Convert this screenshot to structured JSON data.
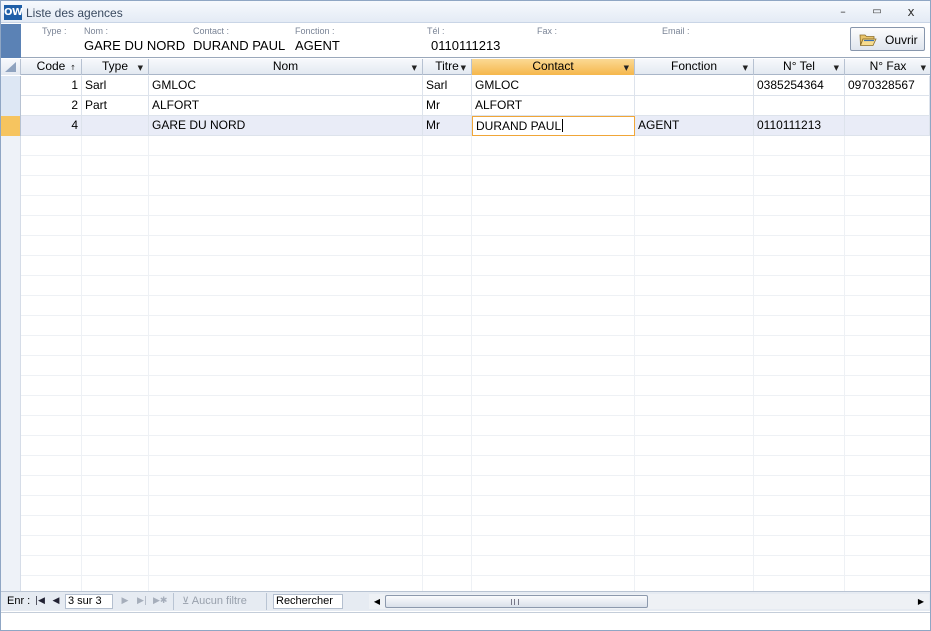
{
  "window": {
    "app_icon_text": "OW",
    "title": "Liste des agences",
    "minimize": "–",
    "maximize": "▭",
    "close": "x"
  },
  "header": {
    "labels": {
      "type": "Type :",
      "nom": "Nom :",
      "contact": "Contact :",
      "fonction": "Fonction :",
      "tel": "Tél :",
      "fax": "Fax :",
      "email": "Email :"
    },
    "values": {
      "nom": "GARE DU NORD",
      "contact": "DURAND PAUL",
      "fonction": "AGENT",
      "tel": "0110111213"
    },
    "open_button": "Ouvrir"
  },
  "grid": {
    "columns": [
      {
        "key": "code",
        "label": "Code",
        "sort": "↑"
      },
      {
        "key": "type",
        "label": "Type",
        "sort": "▼"
      },
      {
        "key": "nom",
        "label": "Nom",
        "sort": "▼"
      },
      {
        "key": "titre",
        "label": "Titre",
        "sort": "▼"
      },
      {
        "key": "contact",
        "label": "Contact",
        "sort": "▼"
      },
      {
        "key": "fonction",
        "label": "Fonction",
        "sort": "▼"
      },
      {
        "key": "tel",
        "label": "N° Tel",
        "sort": "▼"
      },
      {
        "key": "fax",
        "label": "N° Fax",
        "sort": "▼"
      }
    ],
    "rows": [
      {
        "code": "1",
        "type": "Sarl",
        "nom": "GMLOC",
        "titre": "Sarl",
        "contact": "GMLOC",
        "fonction": "",
        "tel": "0385254364",
        "fax": "0970328567"
      },
      {
        "code": "2",
        "type": "Part",
        "nom": "ALFORT",
        "titre": "Mr",
        "contact": "ALFORT",
        "fonction": "",
        "tel": "",
        "fax": ""
      },
      {
        "code": "4",
        "type": "",
        "nom": "GARE DU NORD",
        "titre": "Mr",
        "contact": "DURAND PAUL",
        "fonction": "AGENT",
        "tel": "0110111213",
        "fax": ""
      }
    ]
  },
  "navbar": {
    "label": "Enr :",
    "first": "|◀",
    "prev": "◀",
    "position": "3 sur 3",
    "next": "▶",
    "last": "▶|",
    "new": "▶✱",
    "filter": "Aucun filtre",
    "search": "Rechercher",
    "scroll_left": "◀",
    "scroll_right": "▶"
  },
  "colors": {
    "accent": "#5b82b5",
    "active_header": "#f5b74c",
    "selected_row": "#e9ecf7",
    "edit_border": "#f0a638"
  }
}
